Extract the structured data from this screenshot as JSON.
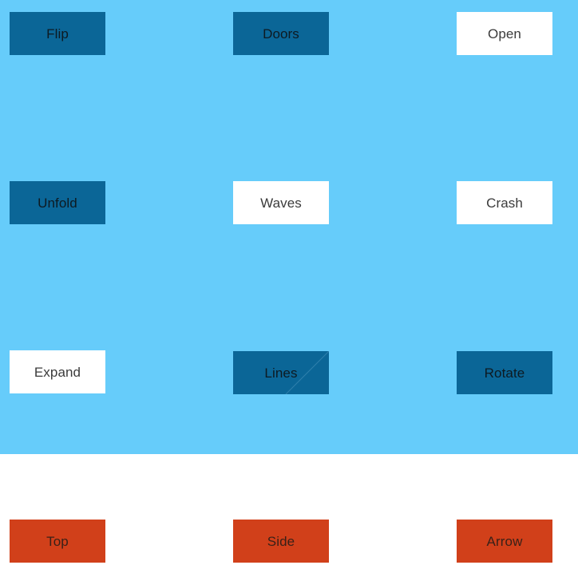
{
  "palette": {
    "panel_blue": "#66ccfa",
    "panel_white": "#ffffff",
    "tile_solid": "#0b6697",
    "tile_light": "#ffffff",
    "tile_accent": "#d1401a",
    "label_dark": "#0d1a22",
    "label_light": "#3b3b3b",
    "label_accent": "#3a2118",
    "diagonal_stroke": "#2f80ac"
  },
  "blue_panel": {
    "rows": [
      {
        "tiles": [
          {
            "label": "Flip",
            "style": "solid"
          },
          {
            "label": "Doors",
            "style": "solid"
          },
          {
            "label": "Open",
            "style": "light"
          }
        ]
      },
      {
        "tiles": [
          {
            "label": "Unfold",
            "style": "solid"
          },
          {
            "label": "Waves",
            "style": "light"
          },
          {
            "label": "Crash",
            "style": "light"
          }
        ]
      },
      {
        "tiles": [
          {
            "label": "Expand",
            "style": "light"
          },
          {
            "label": "Lines",
            "style": "solid",
            "decoration": "diagonal-line"
          },
          {
            "label": "Rotate",
            "style": "solid"
          }
        ]
      }
    ]
  },
  "white_panel": {
    "rows": [
      {
        "tiles": [
          {
            "label": "Top",
            "style": "accent"
          },
          {
            "label": "Side",
            "style": "accent"
          },
          {
            "label": "Arrow",
            "style": "accent"
          }
        ]
      }
    ]
  }
}
